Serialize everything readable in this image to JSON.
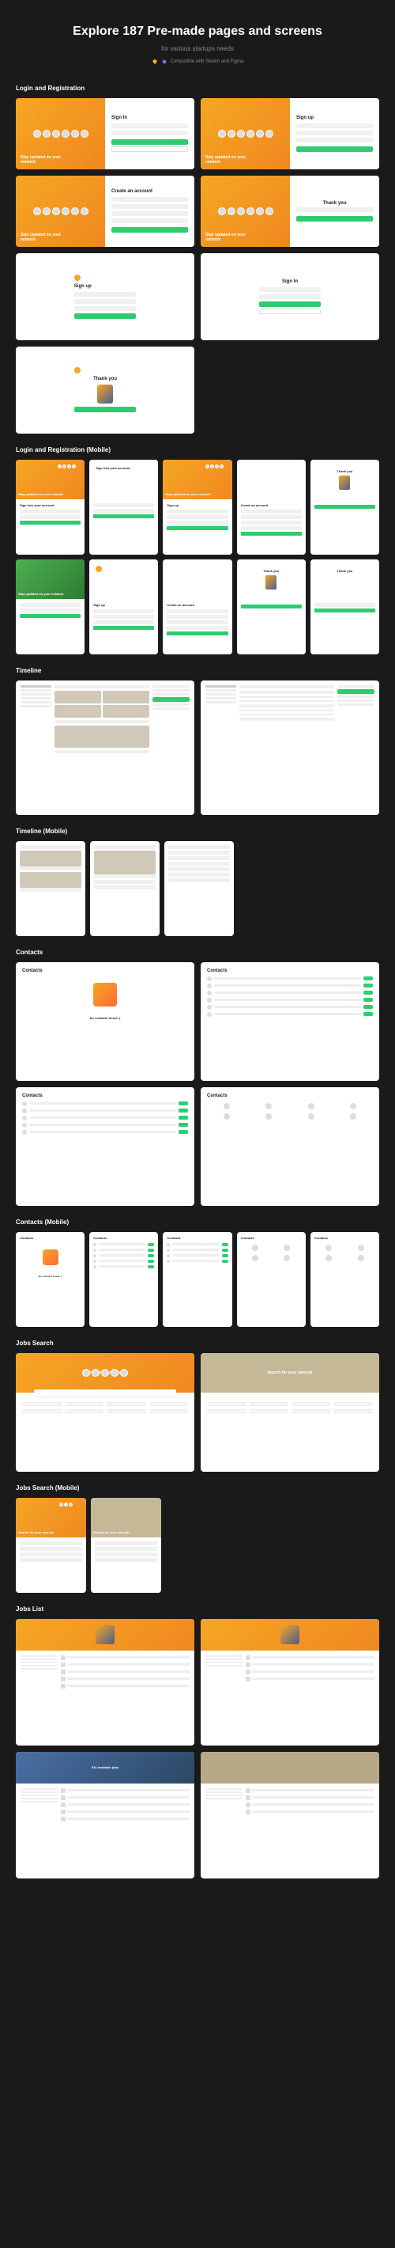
{
  "hero": {
    "title": "Explore 187 Pre-made pages and screens",
    "subtitle": "for various startups needs",
    "compat": "Compatible with Sketch and Figma"
  },
  "sections": {
    "login": "Login and Registration",
    "login_mobile": "Login and Registration (Mobile)",
    "timeline": "Timeline",
    "timeline_mobile": "Timeline (Mobile)",
    "contacts": "Contacts",
    "contacts_mobile": "Contacts (Mobile)",
    "jobs": "Jobs Search",
    "jobs_mobile": "Jobs Search (Mobile)",
    "jobs_list": "Jobs List"
  },
  "forms": {
    "signin": "Sign In",
    "signup": "Sign up",
    "create": "Create an account",
    "signin_account": "Sign into your account",
    "thank": "Thank you",
    "slogan": "Stay updated on your network"
  },
  "contacts": {
    "title": "Contacts",
    "empty": "No contacts found :("
  },
  "jobs": {
    "hero_text": "Search for your new job",
    "results": "916 available jobs"
  },
  "colors": {
    "bg": "#1a1a1a",
    "orange": "#f5a623",
    "green": "#2ecc71"
  }
}
